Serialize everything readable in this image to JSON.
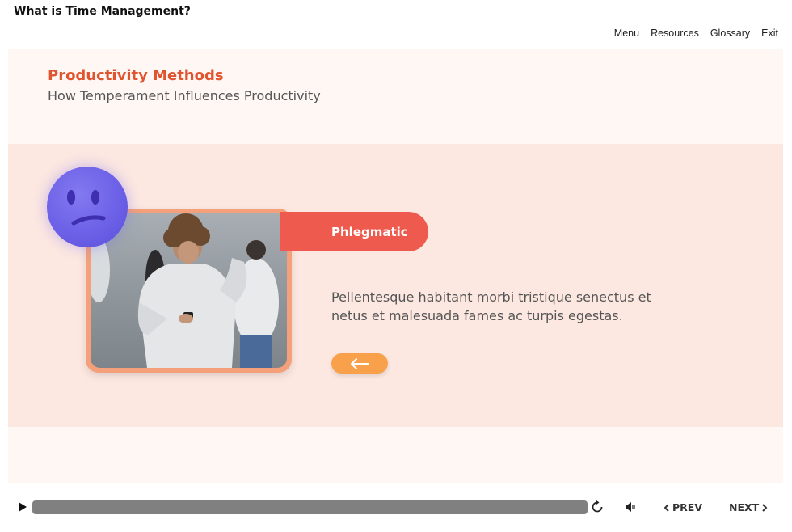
{
  "course": {
    "title": "What is Time Management?"
  },
  "topnav": {
    "menu": "Menu",
    "resources": "Resources",
    "glossary": "Glossary",
    "exit": "Exit"
  },
  "slide": {
    "title": "Productivity Methods",
    "subtitle": "How Temperament Influences Productivity",
    "temperament_label": "Phlegmatic",
    "body": "Pellentesque habitant morbi tristique senectus et netus et malesuada fames ac turpis egestas.",
    "emoji_icon": "confused-face-icon",
    "back_icon": "arrow-left-icon"
  },
  "playbar": {
    "prev_label": "PREV",
    "next_label": "NEXT",
    "icons": [
      "play-icon",
      "replay-icon",
      "volume-icon",
      "chevron-left-icon",
      "chevron-right-icon"
    ]
  },
  "colors": {
    "accent_title": "#e0552f",
    "pill": "#ef5a4f",
    "back_button": "#f8a04a",
    "emoji": "#6a5fe6",
    "content_band": "#fde8e1",
    "slide_bg": "#fff7f3"
  }
}
